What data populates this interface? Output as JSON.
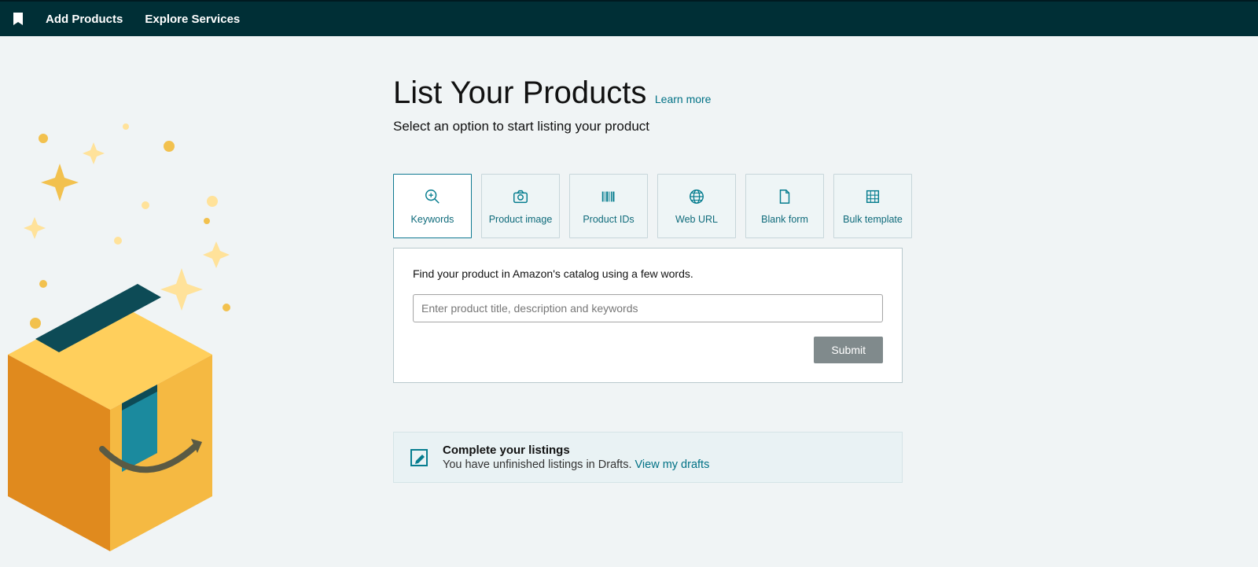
{
  "nav": {
    "items": [
      "Add Products",
      "Explore Services"
    ]
  },
  "page": {
    "title": "List Your Products",
    "learn_more": "Learn more",
    "subtitle": "Select an option to start listing your product"
  },
  "tabs": [
    {
      "label": "Keywords"
    },
    {
      "label": "Product image"
    },
    {
      "label": "Product IDs"
    },
    {
      "label": "Web URL"
    },
    {
      "label": "Blank form"
    },
    {
      "label": "Bulk template"
    }
  ],
  "panel": {
    "desc": "Find your product in Amazon's catalog using a few words.",
    "placeholder": "Enter product title, description and keywords",
    "submit": "Submit"
  },
  "alert": {
    "title": "Complete your listings",
    "body": "You have unfinished listings in Drafts.",
    "link": "View my drafts"
  }
}
